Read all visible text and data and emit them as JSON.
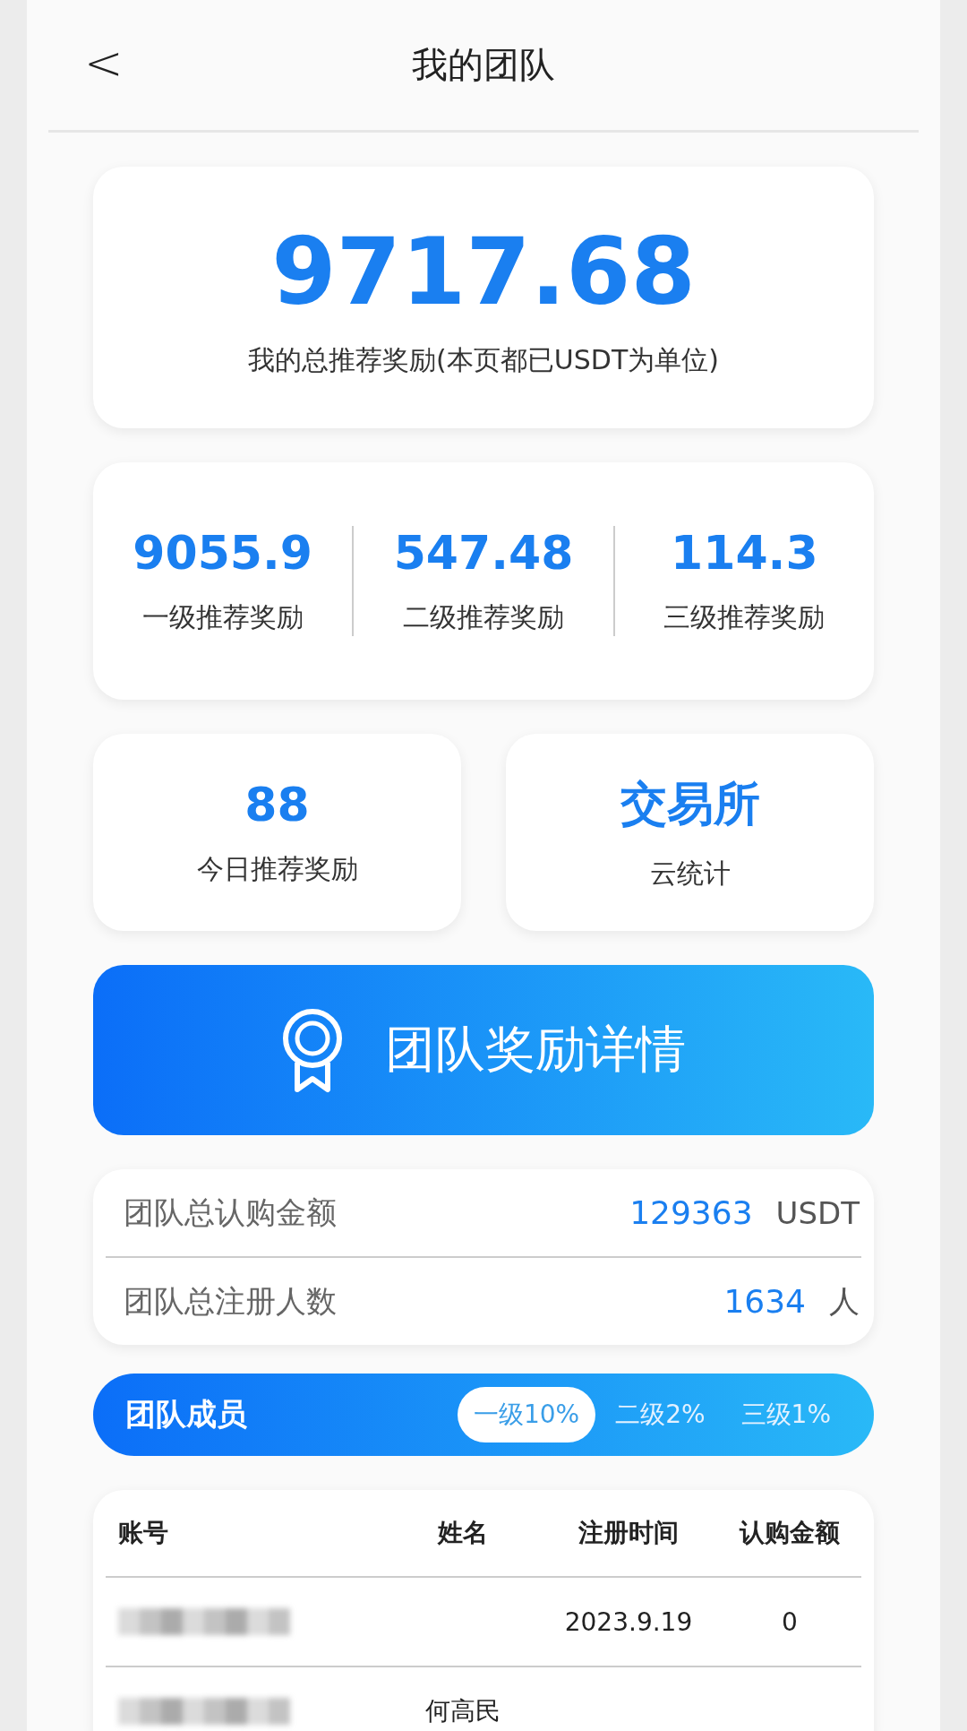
{
  "header": {
    "back": "<",
    "title": "我的团队"
  },
  "total": {
    "amount": "9717.68",
    "label": "我的总推荐奖励(本页都已USDT为单位)"
  },
  "levels": [
    {
      "amount": "9055.9",
      "label": "一级推荐奖励"
    },
    {
      "amount": "547.48",
      "label": "二级推荐奖励"
    },
    {
      "amount": "114.3",
      "label": "三级推荐奖励"
    }
  ],
  "tiles": [
    {
      "value": "88",
      "label": "今日推荐奖励"
    },
    {
      "value": "交易所",
      "label": "云统计"
    }
  ],
  "detail_button": {
    "label": "团队奖励详情"
  },
  "stats": [
    {
      "label": "团队总认购金额",
      "value": "129363",
      "unit": "USDT"
    },
    {
      "label": "团队总注册人数",
      "value": "1634",
      "unit": "人"
    }
  ],
  "members": {
    "title": "团队成员",
    "tabs": [
      {
        "label": "一级10%",
        "selected": true
      },
      {
        "label": "二级2%",
        "selected": false
      },
      {
        "label": "三级1%",
        "selected": false
      }
    ]
  },
  "table": {
    "columns": [
      "账号",
      "姓名",
      "注册时间",
      "认购金额"
    ],
    "rows": [
      {
        "account_blurred": true,
        "name": "",
        "date": "2023.9.19",
        "amount": "0"
      },
      {
        "account_blurred": true,
        "name": "何高民",
        "date": "",
        "amount": ""
      }
    ]
  }
}
